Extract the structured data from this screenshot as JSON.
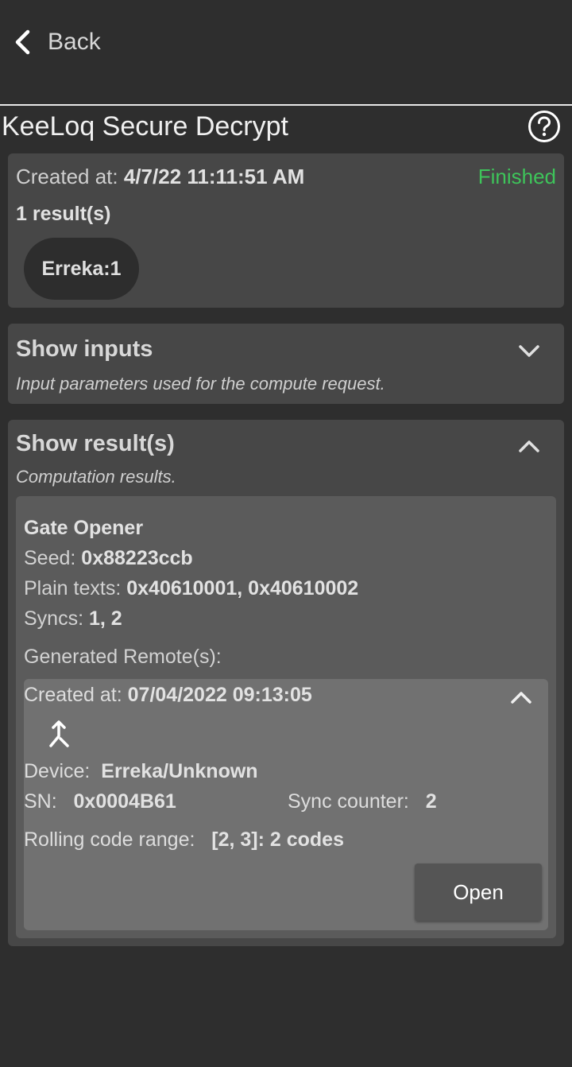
{
  "nav": {
    "back_label": "Back"
  },
  "page": {
    "title": "KeeLoq Secure Decrypt"
  },
  "status_card": {
    "created_label": "Created at:",
    "created_value": "4/7/22 11:11:51 AM",
    "status": "Finished",
    "result_count": "1 result(s)",
    "chip_label": "Erreka:1"
  },
  "inputs_section": {
    "title": "Show inputs",
    "subtitle": "Input parameters used for the compute request.",
    "expanded": false
  },
  "results_section": {
    "title": "Show result(s)",
    "subtitle": "Computation results.",
    "expanded": true,
    "result": {
      "name": "Gate Opener",
      "seed_label": "Seed:",
      "seed_value": "0x88223ccb",
      "plain_label": "Plain texts:",
      "plain_value": "0x40610001, 0x40610002",
      "syncs_label": "Syncs:",
      "syncs_value": "1, 2",
      "generated_label": "Generated Remote(s):",
      "remote": {
        "created_label": "Created at:",
        "created_value": "07/04/2022 09:13:05",
        "device_label": "Device:",
        "device_value": "Erreka/Unknown",
        "sn_label": "SN:",
        "sn_value": "0x0004B61",
        "sync_label": "Sync counter:",
        "sync_value": "2",
        "range_label": "Rolling code range:",
        "range_value": "[2, 3]: 2 codes",
        "open_label": "Open"
      }
    }
  },
  "colors": {
    "background": "#2e2e2e",
    "card": "#474747",
    "inner_card": "#5b5b5b",
    "remote_card": "#717171",
    "status_finished": "#3ec45a"
  },
  "icons": [
    "chevron-left-icon",
    "help-circle-icon",
    "chevron-down-icon",
    "chevron-up-icon",
    "merge-arrow-icon"
  ]
}
